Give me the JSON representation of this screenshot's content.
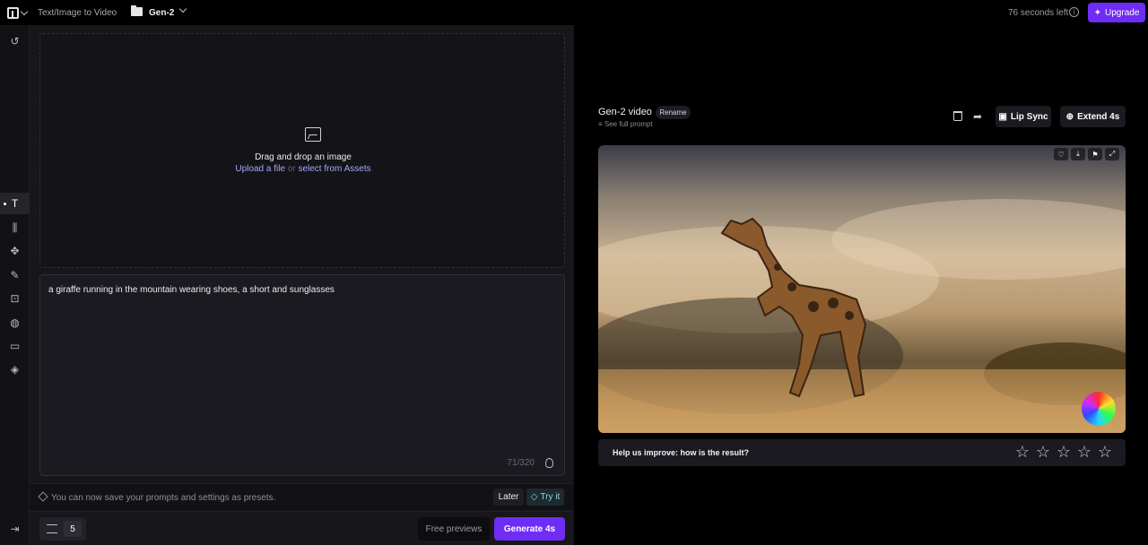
{
  "topbar": {
    "mode": "Text/Image to Video",
    "project": "Gen-2",
    "time_left": "76 seconds left",
    "upgrade_label": "Upgrade"
  },
  "rail": {
    "items": [
      "undo",
      "text",
      "motion-sliders",
      "camera",
      "brush",
      "frame",
      "palette",
      "aspect",
      "presets",
      "collapse"
    ],
    "active": "text"
  },
  "dropzone": {
    "title": "Drag and drop an image",
    "upload_link": "Upload a file",
    "or": "or",
    "assets_link": "select from Assets"
  },
  "prompt": {
    "value": "a giraffe running in the mountain wearing shoes, a short and sunglasses",
    "counter": "71/320"
  },
  "presets_bar": {
    "message": "You can now save your prompts and settings as presets.",
    "later": "Later",
    "try_it": "Try it"
  },
  "bottom": {
    "duration": "5",
    "free_previews": "Free previews",
    "generate": "Generate 4s"
  },
  "output": {
    "title": "Gen-2 video",
    "rename": "Rename",
    "see_full_prompt": "See full prompt",
    "lip_sync": "Lip Sync",
    "extend": "Extend 4s",
    "feedback_question": "Help us improve: how is the result?",
    "rating_stars": 5
  },
  "colors": {
    "accent": "#6f2cf5",
    "background": "#000000",
    "panel": "#16161b"
  }
}
